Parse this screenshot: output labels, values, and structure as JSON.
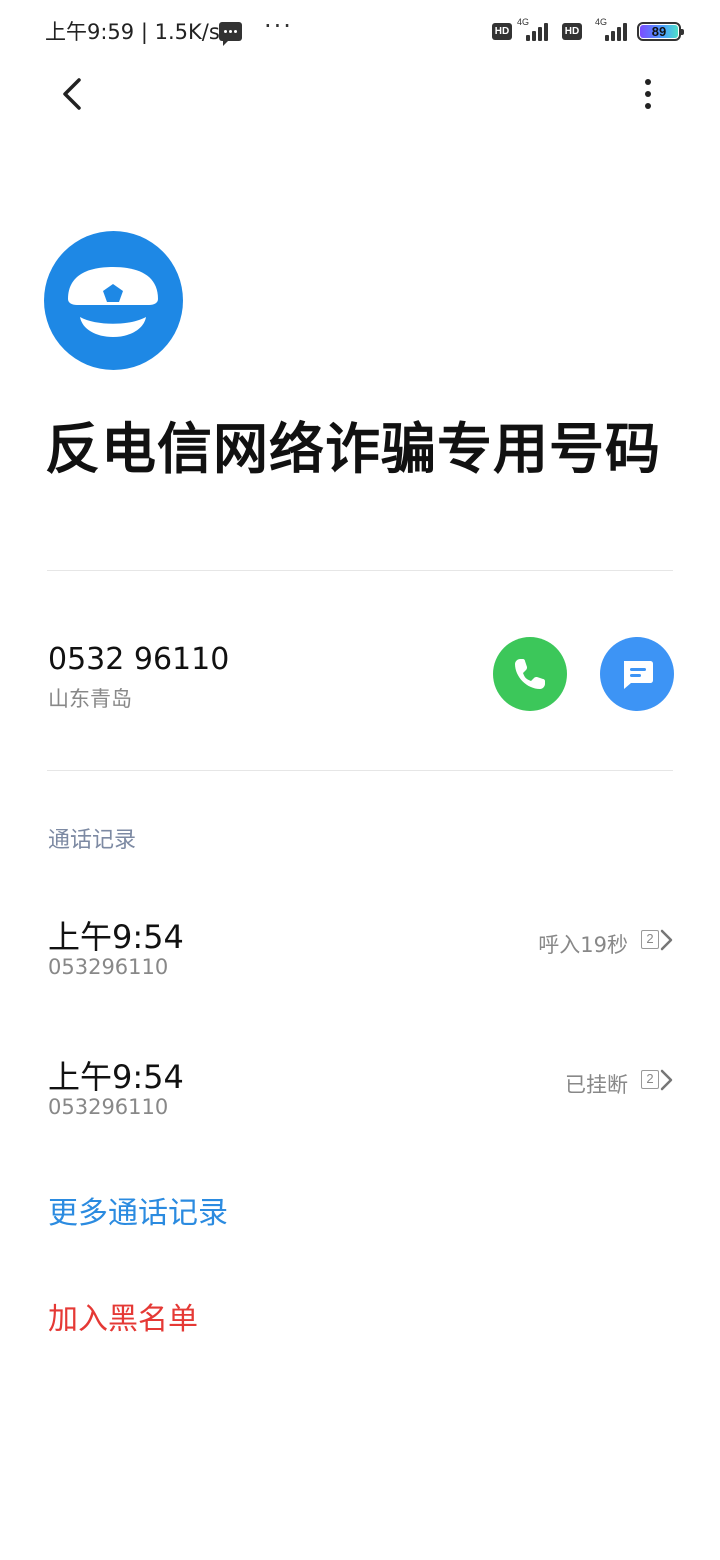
{
  "status_bar": {
    "time_speed": "上午9:59 | 1.5K/s",
    "more_dots": "···",
    "hd1": "HD",
    "net1": "4G",
    "hd2": "HD",
    "net2": "4G",
    "battery": "89",
    "battery_gradient": [
      "#7b4dff",
      "#4aa0ff",
      "#4ee0c8"
    ]
  },
  "contact": {
    "name": "反电信网络诈骗专用号码",
    "avatar_icon": "police-cap-icon",
    "avatar_color": "#1e88e5"
  },
  "number_row": {
    "number": "0532 96110",
    "location": "山东青岛",
    "call_icon": "phone-icon",
    "call_color": "#3cc75a",
    "message_icon": "message-icon",
    "message_color": "#3d94f5"
  },
  "call_log": {
    "title": "通话记录",
    "entries": [
      {
        "time": "上午9:54",
        "number": "053296110",
        "status": "呼入19秒",
        "count": "2"
      },
      {
        "time": "上午9:54",
        "number": "053296110",
        "status": "已挂断",
        "count": "2"
      }
    ]
  },
  "actions": {
    "more_call_log": "更多通话记录",
    "add_to_blacklist": "加入黑名单",
    "more_link_color": "#2b8be0",
    "blacklist_color": "#e53935"
  }
}
